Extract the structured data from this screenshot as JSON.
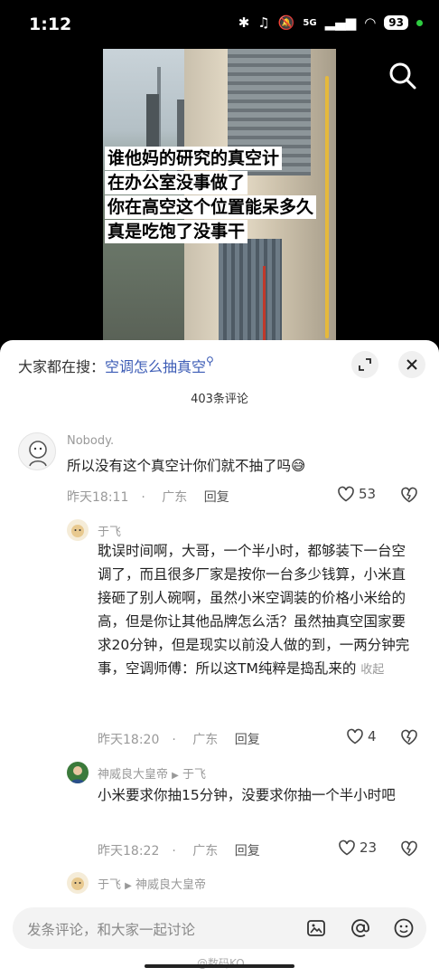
{
  "status_bar": {
    "time": "1:12",
    "battery": "93",
    "network": "5G"
  },
  "video": {
    "overlay_lines": [
      "谁他妈的研究的真空计",
      "在办公室没事做了",
      "你在高空这个位置能呆多久",
      "真是吃饱了没事干"
    ]
  },
  "sheet": {
    "hot_search_prefix": "大家都在搜：",
    "hot_search_keyword": "空调怎么抽真空",
    "comment_count": "403条评论"
  },
  "comments": [
    {
      "user": "Nobody.",
      "text": "所以没有这个真空计你们就不抽了吗😅",
      "time": "昨天18:11",
      "location": "广东",
      "reply_label": "回复",
      "likes": "53"
    },
    {
      "user": "于飞",
      "text": "耽误时间啊，大哥，一个半小时，都够装下一台空调了，而且很多厂家是按你一台多少钱算，小米直接砸了别人碗啊，虽然小米空调装的价格小米给的高，但是你让其他品牌怎么活？虽然抽真空国家要求20分钟，但是现实以前没人做的到，一两分钟完事，空调师傅：所以这TM纯粹是捣乱来的",
      "collapse_label": "收起",
      "time": "昨天18:20",
      "location": "广东",
      "reply_label": "回复",
      "likes": "4"
    },
    {
      "user": "神威良大皇帝",
      "reply_to": "于飞",
      "text": "小米要求你抽15分钟，没要求你抽一个半小时吧",
      "time": "昨天18:22",
      "location": "广东",
      "reply_label": "回复",
      "likes": "23"
    },
    {
      "user": "于飞",
      "reply_to": "神威良大皇帝"
    }
  ],
  "input": {
    "placeholder": "发条评论，和大家一起讨论"
  },
  "watermark": "@数码KO"
}
